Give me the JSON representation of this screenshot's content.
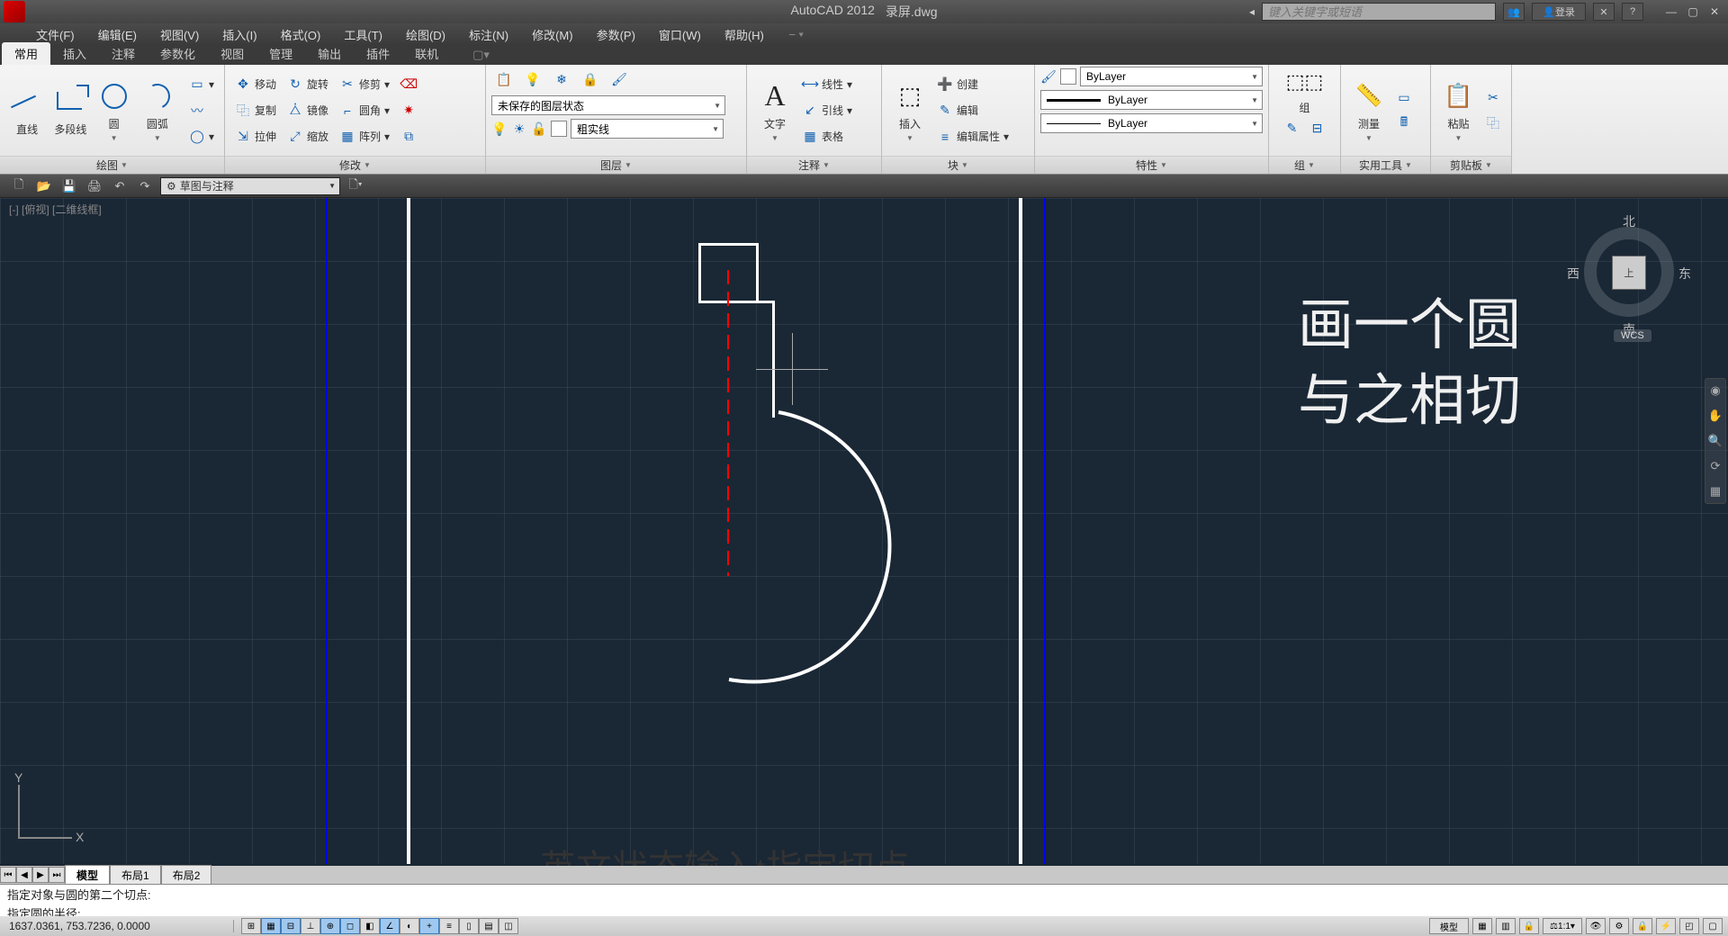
{
  "title": {
    "app": "AutoCAD 2012",
    "file": "录屏.dwg",
    "search_ph": "键入关键字或短语",
    "login": "登录"
  },
  "menu": [
    "文件(F)",
    "编辑(E)",
    "视图(V)",
    "插入(I)",
    "格式(O)",
    "工具(T)",
    "绘图(D)",
    "标注(N)",
    "修改(M)",
    "参数(P)",
    "窗口(W)",
    "帮助(H)"
  ],
  "tabs": [
    "常用",
    "插入",
    "注释",
    "参数化",
    "视图",
    "管理",
    "输出",
    "插件",
    "联机"
  ],
  "active_tab": 0,
  "qat_workspace": "草图与注释",
  "panels": {
    "draw": {
      "title": "绘图",
      "tools": [
        "直线",
        "多段线",
        "圆",
        "圆弧"
      ]
    },
    "modify": {
      "title": "修改",
      "rows": [
        [
          "移动",
          "旋转",
          "修剪"
        ],
        [
          "复制",
          "镜像",
          "圆角"
        ],
        [
          "拉伸",
          "缩放",
          "阵列"
        ]
      ]
    },
    "layer": {
      "title": "图层",
      "state": "未保存的图层状态",
      "extra": "粗实线"
    },
    "annot": {
      "title": "注释",
      "big": "文字",
      "rows": [
        [
          "线性"
        ],
        [
          "引线"
        ],
        [
          "表格"
        ]
      ]
    },
    "insert": {
      "title": "块",
      "big": "插入",
      "rows": [
        [
          "创建"
        ],
        [
          "编辑"
        ],
        [
          "编辑属性"
        ]
      ]
    },
    "prop": {
      "title": "特性",
      "bylayer": "ByLayer"
    },
    "group": {
      "title": "组",
      "big": "组"
    },
    "util": {
      "title": "实用工具",
      "big": "测量"
    },
    "clip": {
      "title": "剪贴板",
      "big": "粘贴"
    }
  },
  "viewport": {
    "label": "[-] [俯视] [二维线框]"
  },
  "viewcube": {
    "n": "北",
    "s": "南",
    "e": "东",
    "w": "西",
    "top": "上",
    "wcs": "WCS"
  },
  "overlay": {
    "l1": "画一个圆",
    "l2": "与之相切",
    "caption": "英文状态输入t指定切点"
  },
  "layout_tabs": [
    "模型",
    "布局1",
    "布局2"
  ],
  "cmd": {
    "l1": "指定对象与圆的第二个切点:",
    "l2": "指定圆的半径:"
  },
  "coords": "1637.0361, 753.7236, 0.0000",
  "status_right": {
    "model": "模型",
    "scale": "1:1"
  }
}
